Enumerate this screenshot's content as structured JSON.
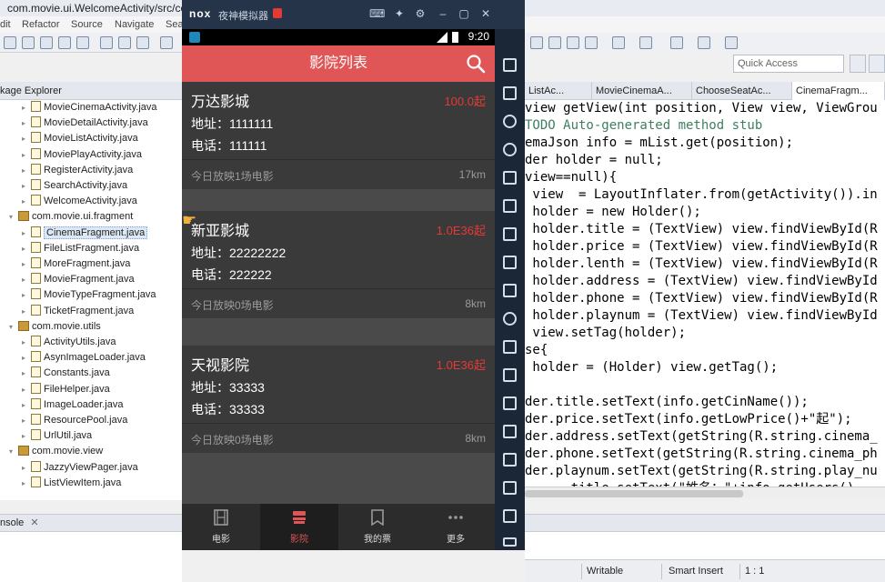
{
  "eclipse": {
    "window_title": "com.movie.ui.WelcomeActivity/src/com",
    "menu": [
      "dit",
      "Refactor",
      "Source",
      "Navigate",
      "Sea"
    ],
    "package_explorer_tab": "kage Explorer",
    "tree": [
      {
        "label": "MovieCinemaActivity.java",
        "kind": "file",
        "depth": 2
      },
      {
        "label": "MovieDetailActivity.java",
        "kind": "file",
        "depth": 2
      },
      {
        "label": "MovieListActivity.java",
        "kind": "file",
        "depth": 2
      },
      {
        "label": "MoviePlayActivity.java",
        "kind": "file",
        "depth": 2
      },
      {
        "label": "RegisterActivity.java",
        "kind": "file",
        "depth": 2
      },
      {
        "label": "SearchActivity.java",
        "kind": "file",
        "depth": 2
      },
      {
        "label": "WelcomeActivity.java",
        "kind": "file",
        "depth": 2
      },
      {
        "label": "com.movie.ui.fragment",
        "kind": "package",
        "depth": 1
      },
      {
        "label": "CinemaFragment.java",
        "kind": "file",
        "depth": 2,
        "selected": true
      },
      {
        "label": "FileListFragment.java",
        "kind": "file",
        "depth": 2
      },
      {
        "label": "MoreFragment.java",
        "kind": "file",
        "depth": 2
      },
      {
        "label": "MovieFragment.java",
        "kind": "file",
        "depth": 2
      },
      {
        "label": "MovieTypeFragment.java",
        "kind": "file",
        "depth": 2
      },
      {
        "label": "TicketFragment.java",
        "kind": "file",
        "depth": 2
      },
      {
        "label": "com.movie.utils",
        "kind": "package",
        "depth": 1
      },
      {
        "label": "ActivityUtils.java",
        "kind": "file",
        "depth": 2
      },
      {
        "label": "AsynImageLoader.java",
        "kind": "file",
        "depth": 2
      },
      {
        "label": "Constants.java",
        "kind": "file",
        "depth": 2
      },
      {
        "label": "FileHelper.java",
        "kind": "file",
        "depth": 2
      },
      {
        "label": "ImageLoader.java",
        "kind": "file",
        "depth": 2
      },
      {
        "label": "ResourcePool.java",
        "kind": "file",
        "depth": 2
      },
      {
        "label": "UrlUtil.java",
        "kind": "file",
        "depth": 2
      },
      {
        "label": "com.movie.view",
        "kind": "package",
        "depth": 1
      },
      {
        "label": "JazzyViewPager.java",
        "kind": "file",
        "depth": 2
      },
      {
        "label": "ListViewItem.java",
        "kind": "file",
        "depth": 2
      }
    ],
    "console_tab": "nsole",
    "quick_access": "Quick Access",
    "editor_tabs": [
      "ListAc...",
      "MovieCinemaA...",
      "ChooseSeatAc...",
      "CinemaFragm..."
    ],
    "code_lines": [
      {
        "text": "view getView(int position, View view, ViewGrou",
        "comment": false
      },
      {
        "text": "TODO Auto-generated method stub",
        "comment": true
      },
      {
        "text": "emaJson info = mList.get(position);",
        "comment": false
      },
      {
        "text": "der holder = null;",
        "comment": false
      },
      {
        "text": "view==null){",
        "comment": false
      },
      {
        "text": " view  = LayoutInflater.from(getActivity()).in",
        "comment": false
      },
      {
        "text": " holder = new Holder();",
        "comment": false
      },
      {
        "text": " holder.title = (TextView) view.findViewById(R",
        "comment": false
      },
      {
        "text": " holder.price = (TextView) view.findViewById(R",
        "comment": false
      },
      {
        "text": " holder.lenth = (TextView) view.findViewById(R",
        "comment": false
      },
      {
        "text": " holder.address = (TextView) view.findViewById",
        "comment": false
      },
      {
        "text": " holder.phone = (TextView) view.findViewById(R",
        "comment": false
      },
      {
        "text": " holder.playnum = (TextView) view.findViewById",
        "comment": false
      },
      {
        "text": " view.setTag(holder);",
        "comment": false
      },
      {
        "text": "se{",
        "comment": false
      },
      {
        "text": " holder = (Holder) view.getTag();",
        "comment": false
      },
      {
        "text": "",
        "comment": false
      },
      {
        "text": "der.title.setText(info.getCinName());",
        "comment": false
      },
      {
        "text": "der.price.setText(info.getLowPrice()+\"起\");",
        "comment": false
      },
      {
        "text": "der.address.setText(getString(R.string.cinema_",
        "comment": false
      },
      {
        "text": "der.phone.setText(getString(R.string.cinema_ph",
        "comment": false
      },
      {
        "text": "der.playnum.setText(getString(R.string.play_nu",
        "comment": false
      },
      {
        "text": "      title.setText(\"姓名：\"+info.getUsers().",
        "comment": false
      }
    ],
    "status": {
      "writable": "Writable",
      "insert_mode": "Smart Insert",
      "position": "1 : 1"
    }
  },
  "emulator": {
    "logo": "nox",
    "name": "夜神模拟器",
    "clock": "9:20",
    "app_title": "影院列表",
    "cinemas": [
      {
        "name": "万达影城",
        "price": "100.0起",
        "address": "地址：1111111",
        "phone": "电话：111111",
        "playing": "今日放映1场电影",
        "distance": "17km"
      },
      {
        "name": "新亚影城",
        "price": "1.0E36起",
        "address": "地址：22222222",
        "phone": "电话：222222",
        "playing": "今日放映0场电影",
        "distance": "8km"
      },
      {
        "name": "天视影院",
        "price": "1.0E36起",
        "address": "地址：33333",
        "phone": "电话：33333",
        "playing": "今日放映0场电影",
        "distance": "8km"
      }
    ],
    "nav": [
      {
        "label": "电影",
        "icon": "film-icon",
        "active": false
      },
      {
        "label": "影院",
        "icon": "cinema-icon",
        "active": true
      },
      {
        "label": "我的票",
        "icon": "ticket-icon",
        "active": false
      },
      {
        "label": "更多",
        "icon": "more-icon",
        "active": false
      }
    ],
    "colors": {
      "appbar": "#e05555",
      "price": "#e53935",
      "card": "#3a3a3a"
    }
  }
}
